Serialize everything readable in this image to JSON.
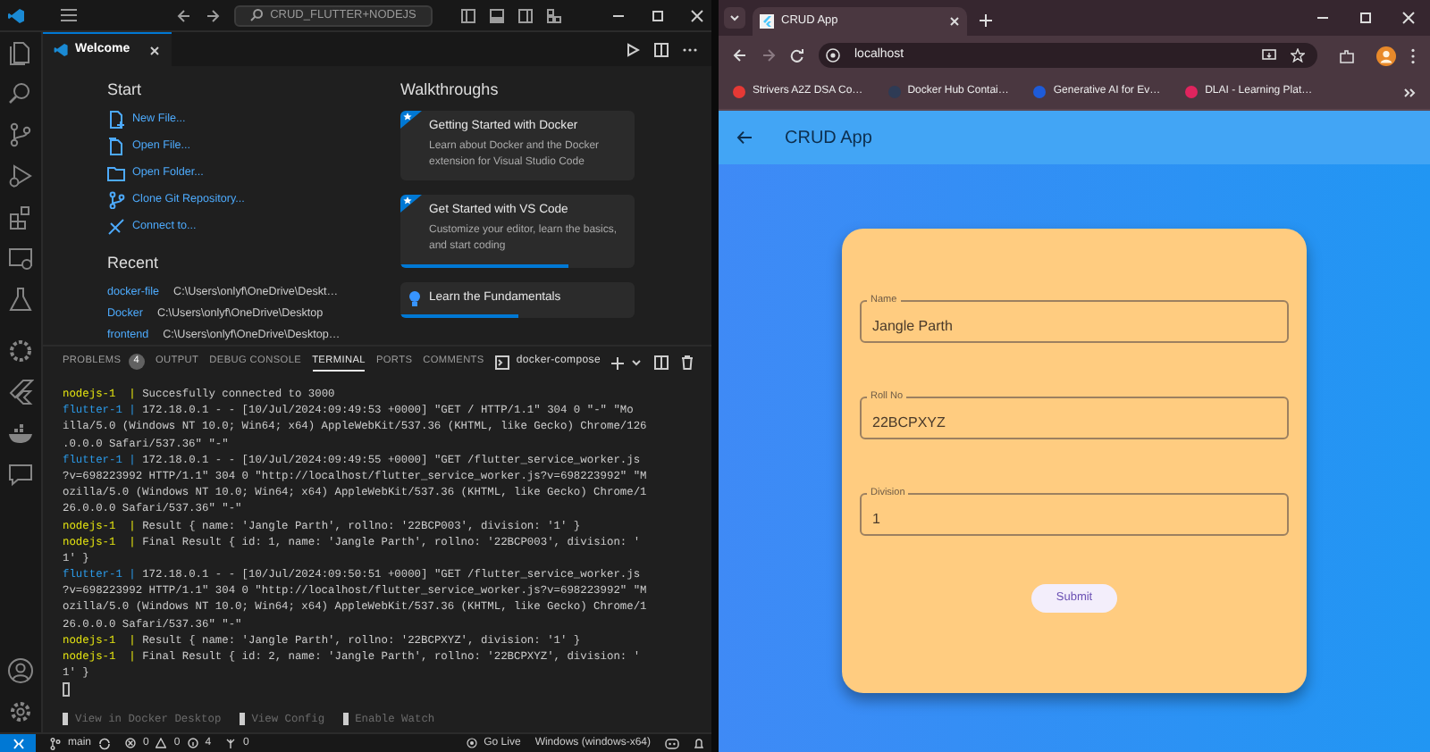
{
  "vscode": {
    "title_search": "CRUD_FLUTTER+NODEJS",
    "editor_tabs": [
      {
        "label": "Welcome",
        "selected": true
      }
    ],
    "welcome": {
      "start_title": "Start",
      "start_actions": [
        {
          "kind": "new-file",
          "label": "New File..."
        },
        {
          "kind": "open-file",
          "label": "Open File..."
        },
        {
          "kind": "open-folder",
          "label": "Open Folder..."
        },
        {
          "kind": "clone",
          "label": "Clone Git Repository..."
        },
        {
          "kind": "connect",
          "label": "Connect to..."
        }
      ],
      "recent_title": "Recent",
      "recent": [
        {
          "name": "docker-file",
          "path": "C:\\Users\\onlyf\\OneDrive\\Deskt…"
        },
        {
          "name": "Docker",
          "path": "C:\\Users\\onlyf\\OneDrive\\Desktop"
        },
        {
          "name": "frontend",
          "path": "C:\\Users\\onlyf\\OneDrive\\Desktop…"
        }
      ],
      "walkthroughs_title": "Walkthroughs",
      "walkthroughs": [
        {
          "kind": "featured",
          "title": "Getting Started with Docker",
          "description": "Learn about Docker and the Docker extension for Visual Studio Code"
        },
        {
          "kind": "featured",
          "title": "Get Started with VS Code",
          "description": "Customize your editor, learn the basics, and start coding",
          "level": 0.72
        },
        {
          "kind": "bulb",
          "title": "Learn the Fundamentals",
          "level": 0.5
        }
      ]
    },
    "panel": {
      "tabs": [
        {
          "label": "PROBLEMS",
          "badge": "4",
          "selected": false
        },
        {
          "label": "OUTPUT",
          "selected": false
        },
        {
          "label": "DEBUG CONSOLE",
          "selected": false
        },
        {
          "label": "TERMINAL",
          "selected": true
        },
        {
          "label": "PORTS",
          "selected": false
        },
        {
          "label": "COMMENTS",
          "selected": false
        }
      ],
      "terminal_name": "docker-compose",
      "lines": [
        {
          "kind": "nodejs",
          "prefix": "nodejs-1  |",
          "text": "Succesfully connected to 3000"
        },
        {
          "kind": "flutter",
          "prefix": "flutter-1 |",
          "text": "172.18.0.1 - - [10/Jul/2024:09:49:53 +0000] \"GET / HTTP/1.1\" 304 0 \"-\" \"Mo"
        },
        {
          "kind": "continuation",
          "text": "illa/5.0 (Windows NT 10.0; Win64; x64) AppleWebKit/537.36 (KHTML, like Gecko) Chrome/126"
        },
        {
          "kind": "continuation",
          "text": ".0.0.0 Safari/537.36\" \"-\""
        },
        {
          "kind": "flutter",
          "prefix": "flutter-1 |",
          "text": "172.18.0.1 - - [10/Jul/2024:09:49:55 +0000] \"GET /flutter_service_worker.js"
        },
        {
          "kind": "continuation",
          "text": "?v=698223992 HTTP/1.1\" 304 0 \"http://localhost/flutter_service_worker.js?v=698223992\" \"M"
        },
        {
          "kind": "continuation",
          "text": "ozilla/5.0 (Windows NT 10.0; Win64; x64) AppleWebKit/537.36 (KHTML, like Gecko) Chrome/1"
        },
        {
          "kind": "continuation",
          "text": "26.0.0.0 Safari/537.36\" \"-\""
        },
        {
          "kind": "nodejs",
          "prefix": "nodejs-1  |",
          "text": "Result { name: 'Jangle Parth', rollno: '22BCP003', division: '1' }"
        },
        {
          "kind": "nodejs",
          "prefix": "nodejs-1  |",
          "text": "Final Result { id: 1, name: 'Jangle Parth', rollno: '22BCP003', division: '"
        },
        {
          "kind": "continuation",
          "text": "1' }"
        },
        {
          "kind": "flutter",
          "prefix": "flutter-1 |",
          "text": "172.18.0.1 - - [10/Jul/2024:09:50:51 +0000] \"GET /flutter_service_worker.js"
        },
        {
          "kind": "continuation",
          "text": "?v=698223992 HTTP/1.1\" 304 0 \"http://localhost/flutter_service_worker.js?v=698223992\" \"M"
        },
        {
          "kind": "continuation",
          "text": "ozilla/5.0 (Windows NT 10.0; Win64; x64) AppleWebKit/537.36 (KHTML, like Gecko) Chrome/1"
        },
        {
          "kind": "continuation",
          "text": "26.0.0.0 Safari/537.36\" \"-\""
        },
        {
          "kind": "nodejs",
          "prefix": "nodejs-1  |",
          "text": "Result { name: 'Jangle Parth', rollno: '22BCPXYZ', division: '1' }"
        },
        {
          "kind": "nodejs",
          "prefix": "nodejs-1  |",
          "text": "Final Result { id: 2, name: 'Jangle Parth', rollno: '22BCPXYZ', division: '"
        },
        {
          "kind": "continuation",
          "text": "1' }"
        }
      ],
      "shortcuts": [
        "View in Docker Desktop",
        "View Config",
        "Enable Watch"
      ]
    },
    "status_bar": {
      "branch": "main",
      "errors": "0",
      "warnings": "0",
      "infos": "4",
      "ports": "0",
      "go_live": "Go Live",
      "platform": "Windows (windows-x64)"
    }
  },
  "browser": {
    "tabs": [
      {
        "title": "CRUD App",
        "selected": true
      }
    ],
    "url": "localhost",
    "bookmarks": [
      {
        "label": "Strivers A2Z DSA Co…",
        "color": "#e53935"
      },
      {
        "label": "Docker Hub Contai…",
        "color": "#2e3b55"
      },
      {
        "label": "Generative AI for Ev…",
        "color": "#1e5bd8"
      },
      {
        "label": "DLAI - Learning Plat…",
        "color": "#e0245e"
      }
    ],
    "app": {
      "title": "CRUD App",
      "fields": [
        {
          "label": "Name",
          "value": "Jangle Parth"
        },
        {
          "label": "Roll No",
          "value": "22BCPXYZ"
        },
        {
          "label": "Division",
          "value": "1"
        }
      ],
      "submit": "Submit"
    }
  }
}
